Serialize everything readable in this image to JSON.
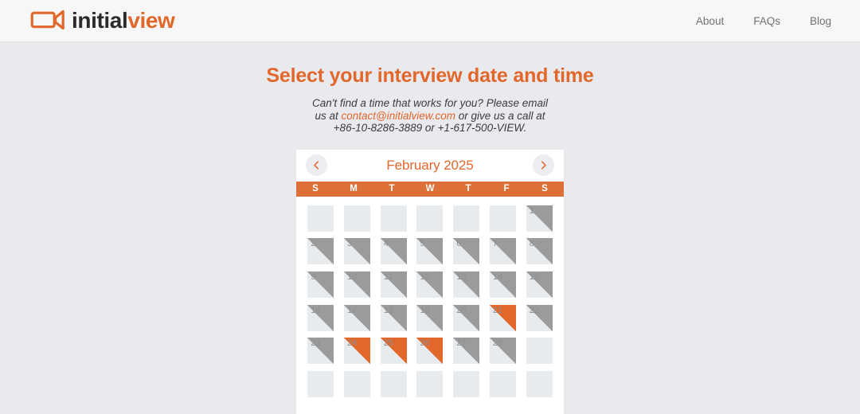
{
  "header": {
    "brand": {
      "icon": "video-camera-icon",
      "text_primary": "initial",
      "text_accent": "view"
    },
    "nav": [
      {
        "label": "About"
      },
      {
        "label": "FAQs"
      },
      {
        "label": "Blog"
      }
    ]
  },
  "main": {
    "title": "Select your interview date and time",
    "subtitle": {
      "part1": "Can't find a time that works for you? Please email us at ",
      "email": "contact@initialview.com",
      "part2": " or give us a call at +86-10-8286-3889 or +1-617-500-VIEW."
    }
  },
  "calendar": {
    "month_label": "February 2025",
    "prev_icon": "chevron-left-icon",
    "next_icon": "chevron-right-icon",
    "weekdays": [
      "S",
      "M",
      "T",
      "W",
      "T",
      "F",
      "S"
    ],
    "accent_color": "#e2672b",
    "weekday_bar_color": "#dd7039",
    "unavailable_color": "#9b9b9b",
    "cell_bg_color": "#e8ebed",
    "cells": [
      {
        "day": "",
        "state": "empty"
      },
      {
        "day": "",
        "state": "empty"
      },
      {
        "day": "",
        "state": "empty"
      },
      {
        "day": "",
        "state": "empty"
      },
      {
        "day": "",
        "state": "empty"
      },
      {
        "day": "",
        "state": "empty"
      },
      {
        "day": "1",
        "state": "unavailable"
      },
      {
        "day": "2",
        "state": "unavailable"
      },
      {
        "day": "3",
        "state": "unavailable"
      },
      {
        "day": "4",
        "state": "unavailable"
      },
      {
        "day": "5",
        "state": "unavailable"
      },
      {
        "day": "6",
        "state": "unavailable"
      },
      {
        "day": "7",
        "state": "unavailable"
      },
      {
        "day": "8",
        "state": "unavailable"
      },
      {
        "day": "9",
        "state": "unavailable"
      },
      {
        "day": "10",
        "state": "unavailable"
      },
      {
        "day": "11",
        "state": "unavailable"
      },
      {
        "day": "12",
        "state": "unavailable"
      },
      {
        "day": "13",
        "state": "unavailable"
      },
      {
        "day": "14",
        "state": "unavailable"
      },
      {
        "day": "15",
        "state": "unavailable"
      },
      {
        "day": "16",
        "state": "unavailable"
      },
      {
        "day": "17",
        "state": "unavailable"
      },
      {
        "day": "18",
        "state": "unavailable"
      },
      {
        "day": "19",
        "state": "unavailable"
      },
      {
        "day": "20",
        "state": "unavailable"
      },
      {
        "day": "21",
        "state": "available"
      },
      {
        "day": "22",
        "state": "unavailable"
      },
      {
        "day": "23",
        "state": "unavailable"
      },
      {
        "day": "24",
        "state": "available"
      },
      {
        "day": "25",
        "state": "available"
      },
      {
        "day": "26",
        "state": "available"
      },
      {
        "day": "27",
        "state": "unavailable"
      },
      {
        "day": "28",
        "state": "unavailable"
      },
      {
        "day": "",
        "state": "empty"
      },
      {
        "day": "",
        "state": "empty"
      },
      {
        "day": "",
        "state": "empty"
      },
      {
        "day": "",
        "state": "empty"
      },
      {
        "day": "",
        "state": "empty"
      },
      {
        "day": "",
        "state": "empty"
      },
      {
        "day": "",
        "state": "empty"
      },
      {
        "day": "",
        "state": "empty"
      }
    ]
  }
}
